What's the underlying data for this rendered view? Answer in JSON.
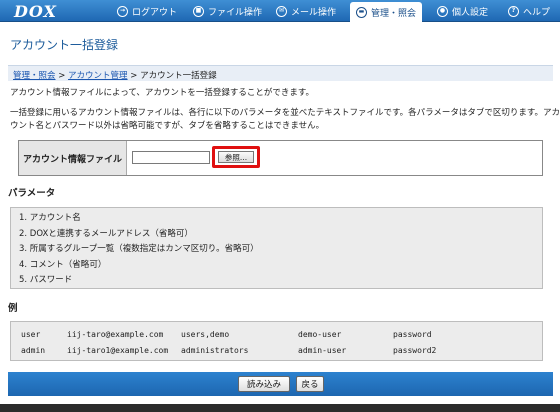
{
  "app": {
    "logo": "DOX"
  },
  "nav": [
    {
      "label": "ログアウト",
      "icon": "logout-icon",
      "glyph": "→",
      "active": false
    },
    {
      "label": "ファイル操作",
      "icon": "file-icon",
      "glyph": "■",
      "active": false
    },
    {
      "label": "メール操作",
      "icon": "mail-icon",
      "glyph": "✉",
      "active": false
    },
    {
      "label": "管理・照会",
      "icon": "admin-icon",
      "glyph": "▬",
      "active": true
    },
    {
      "label": "個人設定",
      "icon": "user-icon",
      "glyph": "●",
      "active": false
    },
    {
      "label": "ヘルプ",
      "icon": "help-icon",
      "glyph": "?",
      "active": false
    }
  ],
  "page": {
    "title": "アカウント一括登録"
  },
  "breadcrumb": {
    "item1": "管理・照会",
    "sep1": " > ",
    "item2": "アカウント管理",
    "sep2": " > ",
    "current": "アカウント一括登録"
  },
  "intro": {
    "line1": "アカウント情報ファイルによって、アカウントを一括登録することができます。",
    "line2": "一括登録に用いるアカウント情報ファイルは、各行に以下のパラメータを並べたテキストファイルです。各パラメータはタブで区切ります。アカ",
    "line3": "ウント名とパスワード以外は省略可能ですが、タブを省略することはできません。"
  },
  "form": {
    "label": "アカウント情報ファイル",
    "file_value": "",
    "browse_label": "参照..."
  },
  "params": {
    "heading": "パラメータ",
    "items": [
      "1. アカウント名",
      "2. DOXと連携するメールアドレス（省略可）",
      "3. 所属するグループ一覧（複数指定はカンマ区切り。省略可）",
      "4. コメント（省略可）",
      "5. パスワード"
    ]
  },
  "example": {
    "heading": "例",
    "rows": [
      [
        "user",
        "iij-taro@example.com",
        "users,demo",
        "demo-user",
        "password"
      ],
      [
        "admin",
        "iij-taro1@example.com",
        "administrators",
        "admin-user",
        "password2"
      ]
    ]
  },
  "actions": {
    "import_label": "読み込み",
    "back_label": "戻る"
  }
}
